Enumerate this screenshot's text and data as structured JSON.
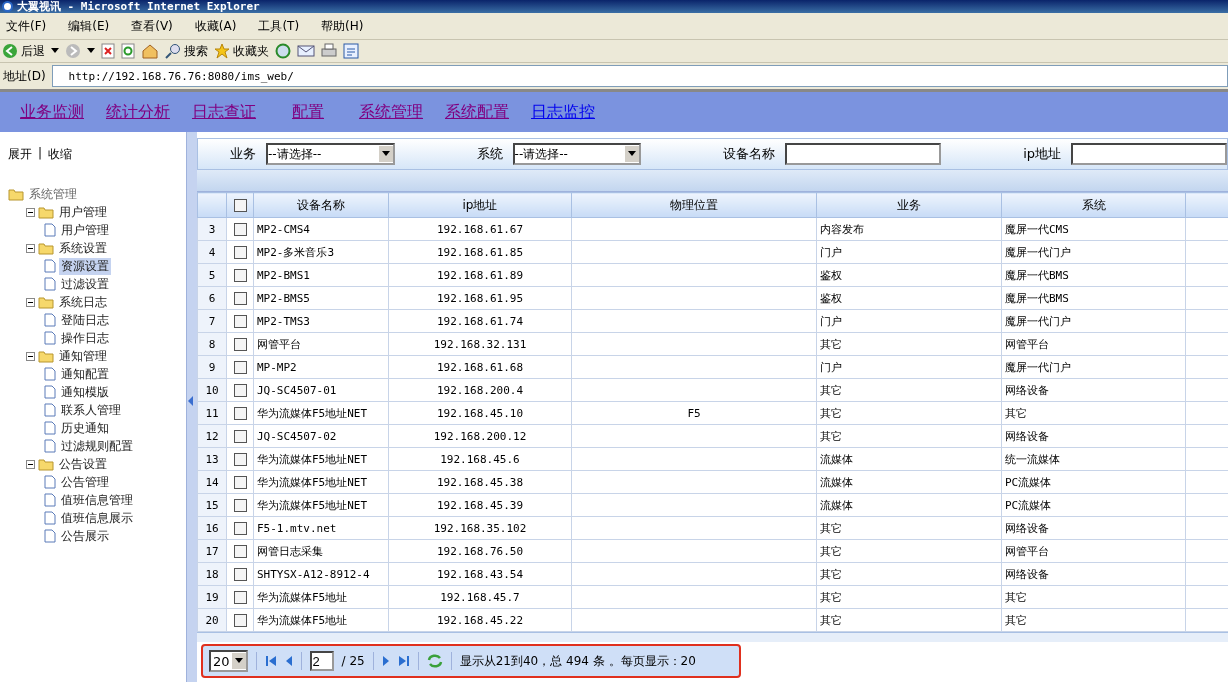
{
  "window": {
    "title": "大翼视讯 - Microsoft Internet Explorer"
  },
  "menu": [
    "文件(F)",
    "编辑(E)",
    "查看(V)",
    "收藏(A)",
    "工具(T)",
    "帮助(H)"
  ],
  "toolbar": {
    "back": "后退",
    "search": "搜索",
    "favorites": "收藏夹"
  },
  "address": {
    "label": "地址(D)",
    "value": "http://192.168.76.76:8080/ims_web/"
  },
  "nav": [
    {
      "label": "业务监测",
      "visited": true
    },
    {
      "label": "统计分析",
      "visited": true
    },
    {
      "label": "日志查证",
      "visited": true
    },
    {
      "label": "配置",
      "visited": true
    },
    {
      "label": "系统管理",
      "visited": true
    },
    {
      "label": "系统配置",
      "visited": true
    },
    {
      "label": "日志监控",
      "visited": false
    }
  ],
  "sidebar": {
    "expand": "展开",
    "separator": "|",
    "collapse": "收缩",
    "tree": [
      {
        "label": "系统管理",
        "children": [
          {
            "label": "用户管理",
            "children": [
              {
                "label": "用户管理",
                "selected": false
              }
            ]
          },
          {
            "label": "系统设置",
            "children": [
              {
                "label": "资源设置",
                "selected": true
              },
              {
                "label": "过滤设置",
                "selected": false
              }
            ]
          },
          {
            "label": "系统日志",
            "children": [
              {
                "label": "登陆日志",
                "selected": false
              },
              {
                "label": "操作日志",
                "selected": false
              }
            ]
          },
          {
            "label": "通知管理",
            "children": [
              {
                "label": "通知配置",
                "selected": false
              },
              {
                "label": "通知模版",
                "selected": false
              },
              {
                "label": "联系人管理",
                "selected": false
              },
              {
                "label": "历史通知",
                "selected": false
              },
              {
                "label": "过滤规则配置",
                "selected": false
              }
            ]
          },
          {
            "label": "公告设置",
            "children": [
              {
                "label": "公告管理",
                "selected": false
              },
              {
                "label": "值班信息管理",
                "selected": false
              },
              {
                "label": "值班信息展示",
                "selected": false
              },
              {
                "label": "公告展示",
                "selected": false
              }
            ]
          }
        ]
      }
    ]
  },
  "filters": [
    {
      "label": "业务",
      "kind": "select",
      "value": "--请选择--"
    },
    {
      "label": "系统",
      "kind": "select",
      "value": "--请选择--"
    },
    {
      "label": "设备名称",
      "kind": "text"
    },
    {
      "label": "ip地址",
      "kind": "text"
    }
  ],
  "table": {
    "columns": [
      "设备名称",
      "ip地址",
      "物理位置",
      "业务",
      "系统"
    ],
    "header_checked": false,
    "rows": [
      {
        "num": "3",
        "checked": false,
        "cells": [
          "MP2-CMS4",
          "192.168.61.67",
          "",
          "内容发布",
          "魔屏一代CMS"
        ]
      },
      {
        "num": "4",
        "checked": false,
        "cells": [
          "MP2-多米音乐3",
          "192.168.61.85",
          "",
          "门户",
          "魔屏一代门户"
        ]
      },
      {
        "num": "5",
        "checked": false,
        "cells": [
          "MP2-BMS1",
          "192.168.61.89",
          "",
          "鉴权",
          "魔屏一代BMS"
        ]
      },
      {
        "num": "6",
        "checked": false,
        "cells": [
          "MP2-BMS5",
          "192.168.61.95",
          "",
          "鉴权",
          "魔屏一代BMS"
        ]
      },
      {
        "num": "7",
        "checked": false,
        "cells": [
          "MP2-TMS3",
          "192.168.61.74",
          "",
          "门户",
          "魔屏一代门户"
        ]
      },
      {
        "num": "8",
        "checked": false,
        "cells": [
          "网管平台",
          "192.168.32.131",
          "",
          "其它",
          "网管平台"
        ]
      },
      {
        "num": "9",
        "checked": false,
        "cells": [
          "MP-MP2",
          "192.168.61.68",
          "",
          "门户",
          "魔屏一代门户"
        ]
      },
      {
        "num": "10",
        "checked": false,
        "cells": [
          "JQ-SC4507-01",
          "192.168.200.4",
          "",
          "其它",
          "网络设备"
        ]
      },
      {
        "num": "11",
        "checked": false,
        "cells": [
          "华为流媒体F5地址NET",
          "192.168.45.10",
          "F5",
          "其它",
          "其它"
        ]
      },
      {
        "num": "12",
        "checked": false,
        "cells": [
          "JQ-SC4507-02",
          "192.168.200.12",
          "",
          "其它",
          "网络设备"
        ]
      },
      {
        "num": "13",
        "checked": false,
        "cells": [
          "华为流媒体F5地址NET",
          "192.168.45.6",
          "",
          "流媒体",
          "统一流媒体"
        ]
      },
      {
        "num": "14",
        "checked": false,
        "cells": [
          "华为流媒体F5地址NET",
          "192.168.45.38",
          "",
          "流媒体",
          "PC流媒体"
        ]
      },
      {
        "num": "15",
        "checked": false,
        "cells": [
          "华为流媒体F5地址NET",
          "192.168.45.39",
          "",
          "流媒体",
          "PC流媒体"
        ]
      },
      {
        "num": "16",
        "checked": false,
        "cells": [
          "F5-1.mtv.net",
          "192.168.35.102",
          "",
          "其它",
          "网络设备"
        ]
      },
      {
        "num": "17",
        "checked": false,
        "cells": [
          "网管日志采集",
          "192.168.76.50",
          "",
          "其它",
          "网管平台"
        ]
      },
      {
        "num": "18",
        "checked": false,
        "cells": [
          "SHTYSX-A12-8912-4",
          "192.168.43.54",
          "",
          "其它",
          "网络设备"
        ]
      },
      {
        "num": "19",
        "checked": false,
        "cells": [
          "华为流媒体F5地址",
          "192.168.45.7",
          "",
          "其它",
          "其它"
        ]
      },
      {
        "num": "20",
        "checked": false,
        "cells": [
          "华为流媒体F5地址",
          "192.168.45.22",
          "",
          "其它",
          "其它"
        ]
      }
    ]
  },
  "pager": {
    "page_size": "20",
    "page": "2",
    "total_pages": "/ 25",
    "summary": "显示从21到40，总 494 条 。每页显示：20",
    "highlighted": true
  }
}
